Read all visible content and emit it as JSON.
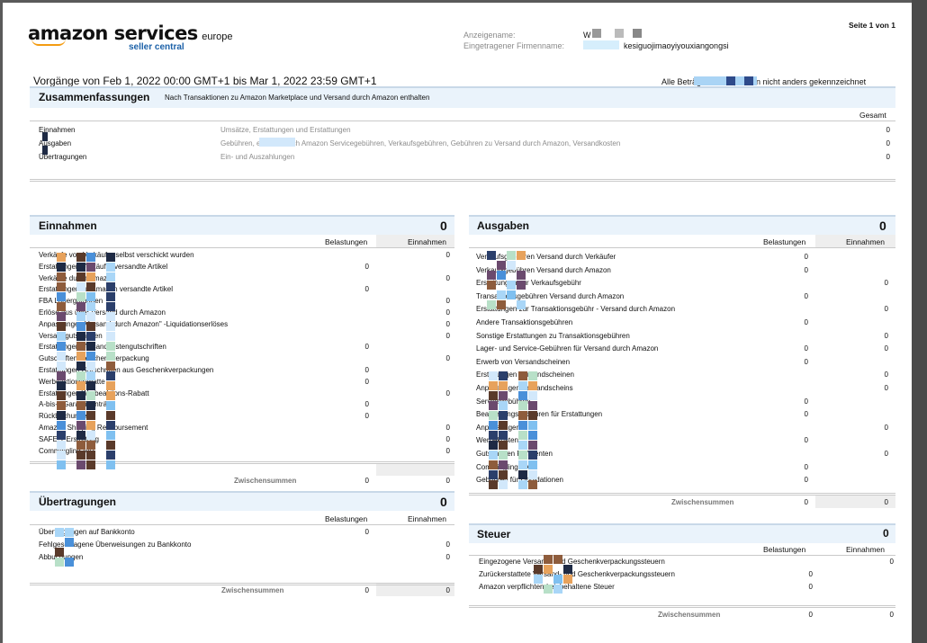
{
  "header": {
    "logo_main": "amazon services",
    "logo_region": "europe",
    "logo_sub": "seller central",
    "display_name_label": "Anzeigename:",
    "display_name_value": "W",
    "company_label": "Eingetragener Firmenname:",
    "company_value": "kesiguojimaoyiyouxiangongsi",
    "page_label": "Seite 1 von 1"
  },
  "period": {
    "text": "Vorgänge von Feb 1, 2022 00:00 GMT+1 bis Mar 1, 2022 23:59 GMT+1",
    "note": "Alle Beträge in EUR, sofern nicht anders gekennzeichnet"
  },
  "summary": {
    "title": "Zusammenfassungen",
    "subtitle": "Nach Transaktionen zu Amazon Marketplace und Versand durch Amazon enthalten",
    "col_total": "Gesamt",
    "rows": [
      {
        "label": "Einnahmen",
        "desc": "Umsätze, Erstattungen und Erstattungen",
        "value": "0"
      },
      {
        "label": "Ausgaben",
        "desc": "Gebühren, einschließlich Amazon Servicegebühren, Verkaufsgebühren, Gebühren zu Versand durch Amazon, Versandkosten",
        "value": "0"
      },
      {
        "label": "Übertragungen",
        "desc": "Ein- und Auszahlungen",
        "value": "0"
      }
    ]
  },
  "income": {
    "title": "Einnahmen",
    "total": "0",
    "col_charges": "Belastungen",
    "col_income": "Einnahmen",
    "rows": [
      {
        "label": "Verkäufe von Verkäufer selbst verschickt wurden",
        "charge": "",
        "income": "0"
      },
      {
        "label": "Erstattungen Verkäufer versandte Artikel",
        "charge": "0",
        "income": ""
      },
      {
        "label": "Verkäufe durch Amazon",
        "charge": "",
        "income": "0"
      },
      {
        "label": "Erstattungen an Amazon versandte Artikel",
        "charge": "0",
        "income": ""
      },
      {
        "label": "FBA Lagerguthaben",
        "charge": "",
        "income": "0"
      },
      {
        "label": "Erlöse aus über Versand durch Amazon",
        "charge": "",
        "income": "0"
      },
      {
        "label": "Anpassungen Versand durch Amazon\" -Liquidationserlöses",
        "charge": "",
        "income": "0"
      },
      {
        "label": "Versandgutschriften",
        "charge": "",
        "income": "0"
      },
      {
        "label": "Erstattungen Versandkostengutschriften",
        "charge": "0",
        "income": ""
      },
      {
        "label": "Gutschriften Geschenkverpackung",
        "charge": "",
        "income": "0"
      },
      {
        "label": "Erstattungen Gutschriften aus Geschenkverpackungen",
        "charge": "0",
        "income": ""
      },
      {
        "label": "Werbeaktionsrabatte",
        "charge": "0",
        "income": ""
      },
      {
        "label": "Erstattungen Werbeaktions-Rabatt",
        "charge": "",
        "income": "0"
      },
      {
        "label": "A-bis-z Garantieanträge",
        "charge": "0",
        "income": ""
      },
      {
        "label": "Rückbuchungen",
        "charge": "0",
        "income": ""
      },
      {
        "label": "Amazon Shipping Reimbursement",
        "charge": "",
        "income": "0"
      },
      {
        "label": "SAFE-T Erstattung",
        "charge": "",
        "income": "0"
      },
      {
        "label": "Commingling VAT",
        "charge": "",
        "income": "0"
      }
    ],
    "subtotal_label": "Zwischensummen",
    "subtotal_charge": "0",
    "subtotal_income": "0"
  },
  "expenses": {
    "title": "Ausgaben",
    "total": "0",
    "col_charges": "Belastungen",
    "col_income": "Einnahmen",
    "rows": [
      {
        "label": "Verkaufsgebühren Versand durch Verkäufer",
        "charge": "0",
        "income": ""
      },
      {
        "label": "Verkaufsgebühren Versand durch Amazon",
        "charge": "0",
        "income": ""
      },
      {
        "label": "Erstattungen zur Verkaufsgebühr",
        "charge": "",
        "income": "0"
      },
      {
        "label": "Transaktionsgebühren Versand durch Amazon",
        "charge": "0",
        "income": ""
      },
      {
        "label": "Erstattungen zur Transaktionsgebühr - Versand durch Amazon",
        "charge": "",
        "income": "0"
      },
      {
        "label": "Andere Transaktionsgebühren",
        "charge": "0",
        "income": ""
      },
      {
        "label": "Sonstige Erstattungen zu Transaktionsgebühren",
        "charge": "",
        "income": "0"
      },
      {
        "label": "Lager- und Service-Gebühren für Versand durch Amazon",
        "charge": "0",
        "income": "0"
      },
      {
        "label": "Erwerb von Versandscheinen",
        "charge": "0",
        "income": ""
      },
      {
        "label": "Erstattungen Versandscheinen",
        "charge": "",
        "income": "0"
      },
      {
        "label": "Anpassungen Versandscheins",
        "charge": "",
        "income": "0"
      },
      {
        "label": "Servicegebühren",
        "charge": "0",
        "income": ""
      },
      {
        "label": "Bearbeitungsgebühren für Erstattungen",
        "charge": "0",
        "income": ""
      },
      {
        "label": "Anpassungen",
        "charge": "",
        "income": "0"
      },
      {
        "label": "Werbekosten",
        "charge": "0",
        "income": ""
      },
      {
        "label": "Gutschriften Referenten",
        "charge": "",
        "income": "0"
      },
      {
        "label": "Commingling VAT",
        "charge": "0",
        "income": ""
      },
      {
        "label": "Gebühren für Liquidationen",
        "charge": "0",
        "income": ""
      }
    ],
    "subtotal_label": "Zwischensummen",
    "subtotal_charge": "0",
    "subtotal_income": "0"
  },
  "transfers": {
    "title": "Übertragungen",
    "total": "0",
    "col_charges": "Belastungen",
    "col_income": "Einnahmen",
    "rows": [
      {
        "label": "Übertragungen auf Bankkonto",
        "charge": "0",
        "income": ""
      },
      {
        "label": "Fehlgeschlagene Überweisungen zu Bankkonto",
        "charge": "",
        "income": "0"
      },
      {
        "label": "Abbuchungen",
        "charge": "",
        "income": "0"
      }
    ],
    "subtotal_label": "Zwischensummen",
    "subtotal_charge": "0",
    "subtotal_income": "0"
  },
  "tax": {
    "title": "Steuer",
    "total": "0",
    "col_charges": "Belastungen",
    "col_income": "Einnahmen",
    "rows": [
      {
        "label": "Eingezogene Versand- und Geschenkverpackungssteuern",
        "charge": "",
        "income": "0"
      },
      {
        "label": "Zurückerstattete Versand- und Geschenkverpackungssteuern",
        "charge": "0",
        "income": ""
      },
      {
        "label": "Amazon verpflichtend einbehaltene Steuer",
        "charge": "0",
        "income": ""
      }
    ],
    "subtotal_label": "Zwischensummen",
    "subtotal_charge": "0",
    "subtotal_income": "0"
  },
  "colors": {
    "band": "#eaf3fb",
    "logo_orange": "#f39c12",
    "logo_blue": "#1c61a8"
  }
}
